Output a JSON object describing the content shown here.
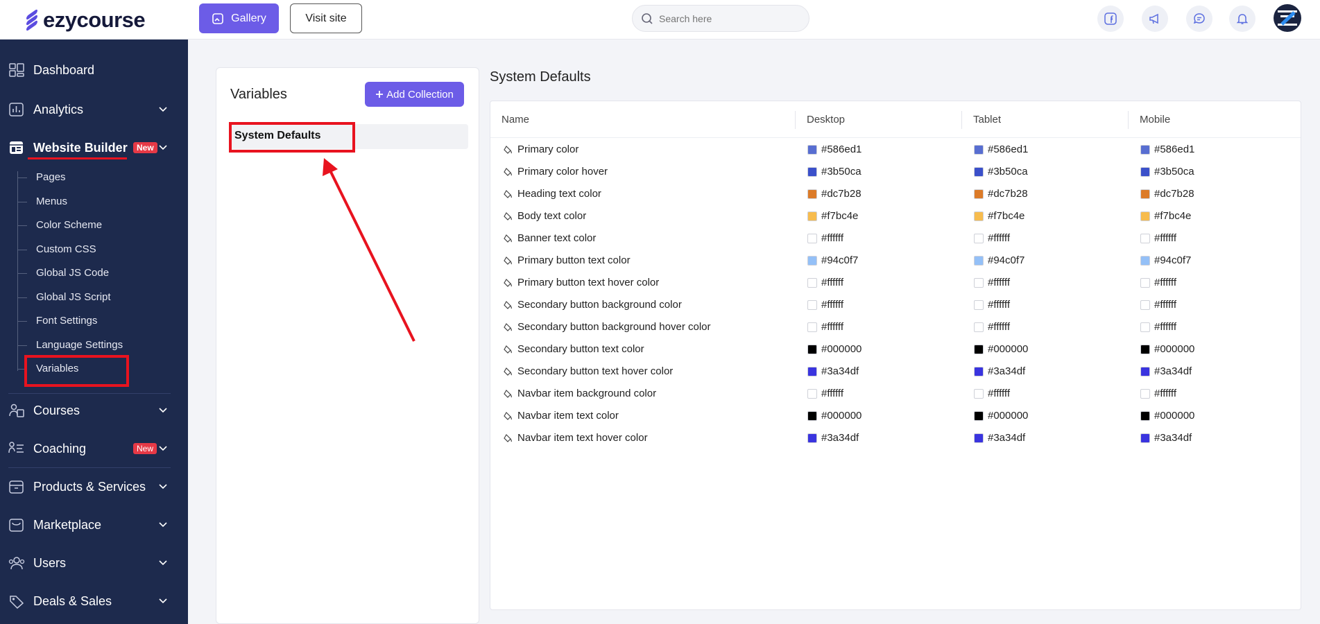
{
  "header": {
    "logo_text": "ezycourse",
    "gallery_label": "Gallery",
    "visit_label": "Visit site",
    "search_placeholder": "Search here",
    "icons": [
      "facebook-icon",
      "megaphone-icon",
      "chat-icon",
      "bell-icon"
    ]
  },
  "sidebar": {
    "items": [
      {
        "label": "Dashboard",
        "icon": "dashboard-icon"
      },
      {
        "label": "Analytics",
        "icon": "analytics-icon"
      },
      {
        "label": "Website Builder",
        "icon": "website-builder-icon",
        "badge": "New"
      },
      {
        "label": "Courses",
        "icon": "courses-icon"
      },
      {
        "label": "Coaching",
        "icon": "coaching-icon",
        "badge": "New"
      },
      {
        "label": "Products & Services",
        "icon": "products-icon"
      },
      {
        "label": "Marketplace",
        "icon": "marketplace-icon"
      },
      {
        "label": "Users",
        "icon": "users-icon"
      },
      {
        "label": "Deals & Sales",
        "icon": "deals-icon"
      }
    ],
    "sub_items": [
      "Pages",
      "Menus",
      "Color Scheme",
      "Custom CSS",
      "Global JS Code",
      "Global JS Script",
      "Font Settings",
      "Language Settings",
      "Variables"
    ]
  },
  "variables_panel": {
    "title": "Variables",
    "add_label": "Add Collection",
    "collection": "System Defaults"
  },
  "table": {
    "section_title": "System Defaults",
    "columns": [
      "Name",
      "Desktop",
      "Tablet",
      "Mobile"
    ],
    "rows": [
      {
        "name": "Primary color",
        "value": "#586ed1"
      },
      {
        "name": "Primary color hover",
        "value": "#3b50ca"
      },
      {
        "name": "Heading text color",
        "value": "#dc7b28"
      },
      {
        "name": "Body text color",
        "value": "#f7bc4e"
      },
      {
        "name": "Banner text color",
        "value": "#ffffff"
      },
      {
        "name": "Primary button text color",
        "value": "#94c0f7"
      },
      {
        "name": "Primary button text hover color",
        "value": "#ffffff"
      },
      {
        "name": "Secondary button background color",
        "value": "#ffffff"
      },
      {
        "name": "Secondary button background hover color",
        "value": "#ffffff"
      },
      {
        "name": "Secondary button text color",
        "value": "#000000"
      },
      {
        "name": "Secondary button text hover color",
        "value": "#3a34df"
      },
      {
        "name": "Navbar item background color",
        "value": "#ffffff"
      },
      {
        "name": "Navbar item text color",
        "value": "#000000"
      },
      {
        "name": "Navbar item text hover color",
        "value": "#3a34df"
      }
    ]
  },
  "colors": {
    "accent": "#6c5ce7",
    "sidebar_bg": "#1d2a4d",
    "highlight": "#e8131f"
  }
}
